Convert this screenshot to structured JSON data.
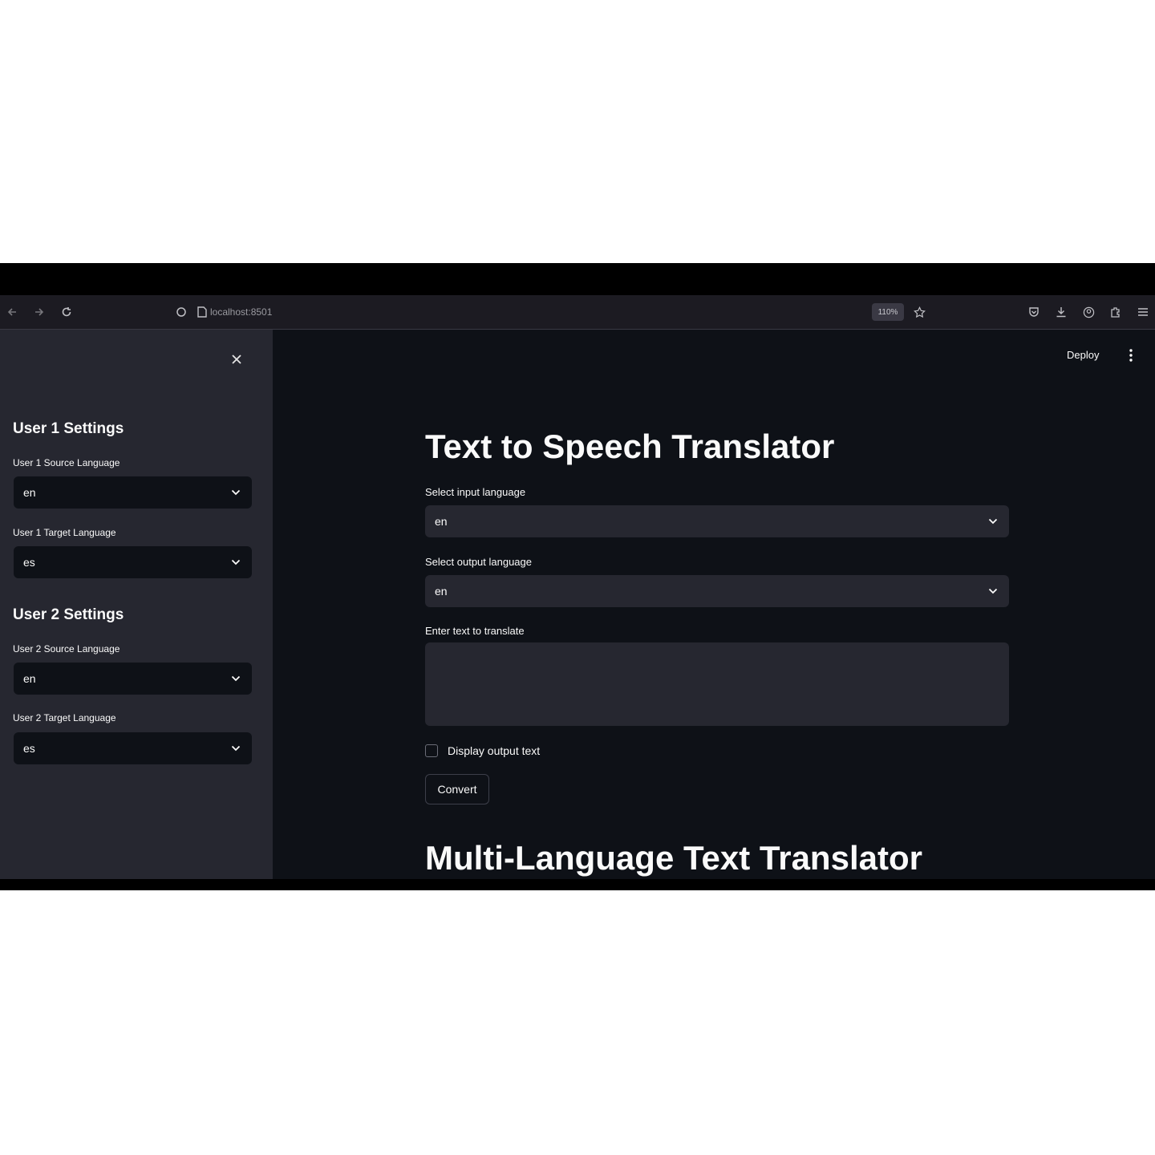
{
  "browser": {
    "url": "localhost:8501",
    "zoom": "110%"
  },
  "header": {
    "deploy_label": "Deploy"
  },
  "sidebar": {
    "close_icon": "close-icon",
    "user1": {
      "heading": "User 1 Settings",
      "source_label": "User 1 Source Language",
      "source_value": "en",
      "target_label": "User 1 Target Language",
      "target_value": "es"
    },
    "user2": {
      "heading": "User 2 Settings",
      "source_label": "User 2 Source Language",
      "source_value": "en",
      "target_label": "User 2 Target Language",
      "target_value": "es"
    }
  },
  "main": {
    "title": "Text to Speech Translator",
    "input_lang_label": "Select input language",
    "input_lang_value": "en",
    "output_lang_label": "Select output language",
    "output_lang_value": "en",
    "text_label": "Enter text to translate",
    "text_value": "",
    "display_output_label": "Display output text",
    "display_output_checked": false,
    "convert_label": "Convert",
    "second_title": "Multi-Language Text Translator"
  },
  "colors": {
    "app_bg": "#0e1117",
    "sidebar_bg": "#262730",
    "text": "#fafafa"
  }
}
